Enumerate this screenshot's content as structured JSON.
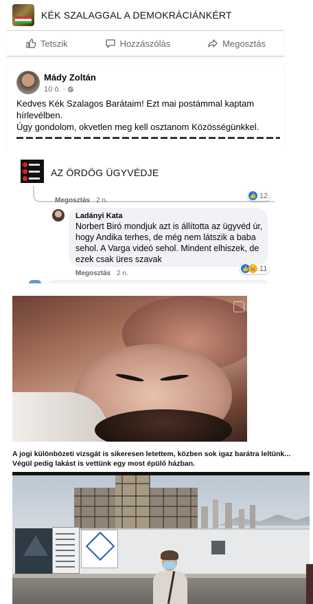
{
  "group1": {
    "title": "KÉK SZALAGGAL A DEMOKRÁCIÁNKÉRT"
  },
  "actions": {
    "like": "Tetszik",
    "comment": "Hozzászólás",
    "share": "Megosztás"
  },
  "post": {
    "author": "Mády Zoltán",
    "time": "10 ó.",
    "lines": [
      "Kedves Kék Szalagos Barátaim! Ezt mai postámmal kaptam",
      "hírlevélben.",
      "Úgy gondolom, okvetlen meg kell osztanom Közösségünkkel."
    ]
  },
  "group2": {
    "title": "AZ ÖRDÖG ÜGYVÉDJE"
  },
  "comments": {
    "first_share": "Megosztás",
    "first_time": "2 n.",
    "first_react_count": "12",
    "name": "Ladányi Kata",
    "lines": [
      "Norbert Biró mondjuk azt is állította az ügyvéd úr,",
      "hogy Andika terhes, de még nem látszik a baba",
      "sehol. A Varga videó sehol. Mindent elhiszek, de",
      "ezek csak üres szavak"
    ],
    "share": "Megosztás",
    "time": "2 n.",
    "react_count": "11"
  },
  "caption": {
    "line1": "A jogi különbözeti vizsgát is sikeresen letettem, közben sok igaz barátra leltünk...",
    "line2": "Végül pedig lakást is vettünk egy most épülő házban."
  }
}
